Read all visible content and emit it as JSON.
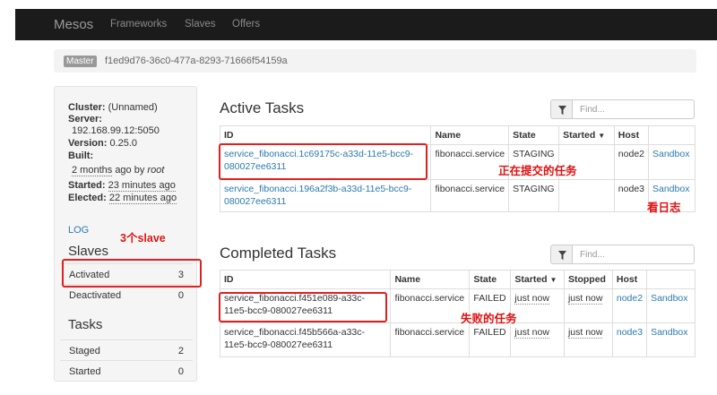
{
  "nav": {
    "brand": "Mesos",
    "items": [
      "Frameworks",
      "Slaves",
      "Offers"
    ]
  },
  "breadcrumb": {
    "label": "Master",
    "id": "f1ed9d76-36c0-477a-8293-71666f54159a"
  },
  "sidebar": {
    "cluster_label": "Cluster:",
    "cluster_value": "(Unnamed)",
    "server_label": "Server:",
    "server_value": "192.168.99.12:5050",
    "version_label": "Version:",
    "version_value": "0.25.0",
    "built_label": "Built:",
    "built_ago": "2 months",
    "built_suffix": "ago by",
    "built_by": "root",
    "started_label": "Started:",
    "started_value": "23 minutes ago",
    "elected_label": "Elected:",
    "elected_value": "22 minutes ago",
    "log": "LOG",
    "slaves_heading": "Slaves",
    "slaves": [
      {
        "label": "Activated",
        "count": "3"
      },
      {
        "label": "Deactivated",
        "count": "0"
      }
    ],
    "tasks_heading": "Tasks",
    "tasks": [
      {
        "label": "Staged",
        "count": "2"
      },
      {
        "label": "Started",
        "count": "0"
      }
    ]
  },
  "active": {
    "title": "Active Tasks",
    "search_placeholder": "Find...",
    "headers": {
      "id": "ID",
      "name": "Name",
      "state": "State",
      "started": "Started",
      "started_arrow": "▼",
      "host": "Host"
    },
    "rows": [
      {
        "id1": "service_fibonacci.1c69175c-a33d-11e5-bcc9-",
        "id2": "080027ee6311",
        "name": "fibonacci.service",
        "state": "STAGING",
        "started": "",
        "host": "node2",
        "sandbox": "Sandbox"
      },
      {
        "id1": "service_fibonacci.196a2f3b-a33d-11e5-bcc9-",
        "id2": "080027ee6311",
        "name": "fibonacci.service",
        "state": "STAGING",
        "started": "",
        "host": "node3",
        "sandbox": "Sandbox"
      }
    ]
  },
  "completed": {
    "title": "Completed Tasks",
    "search_placeholder": "Find...",
    "headers": {
      "id": "ID",
      "name": "Name",
      "state": "State",
      "started": "Started",
      "started_arrow": "▼",
      "stopped": "Stopped",
      "host": "Host"
    },
    "rows": [
      {
        "id1": "service_fibonacci.f451e089-a33c-",
        "id2": "11e5-bcc9-080027ee6311",
        "name": "fibonacci.service",
        "state": "FAILED",
        "started": "just now",
        "stopped": "just now",
        "host": "node2",
        "sandbox": "Sandbox"
      },
      {
        "id1": "service_fibonacci.f45b566a-a33c-",
        "id2": "11e5-bcc9-080027ee6311",
        "name": "fibonacci.service",
        "state": "FAILED",
        "started": "just now",
        "stopped": "just now",
        "host": "node3",
        "sandbox": "Sandbox"
      }
    ]
  },
  "annotations": {
    "slaves_count": "3个slave",
    "submitting": "正在提交的任务",
    "logs": "看日志",
    "failed": "失败的任务"
  }
}
